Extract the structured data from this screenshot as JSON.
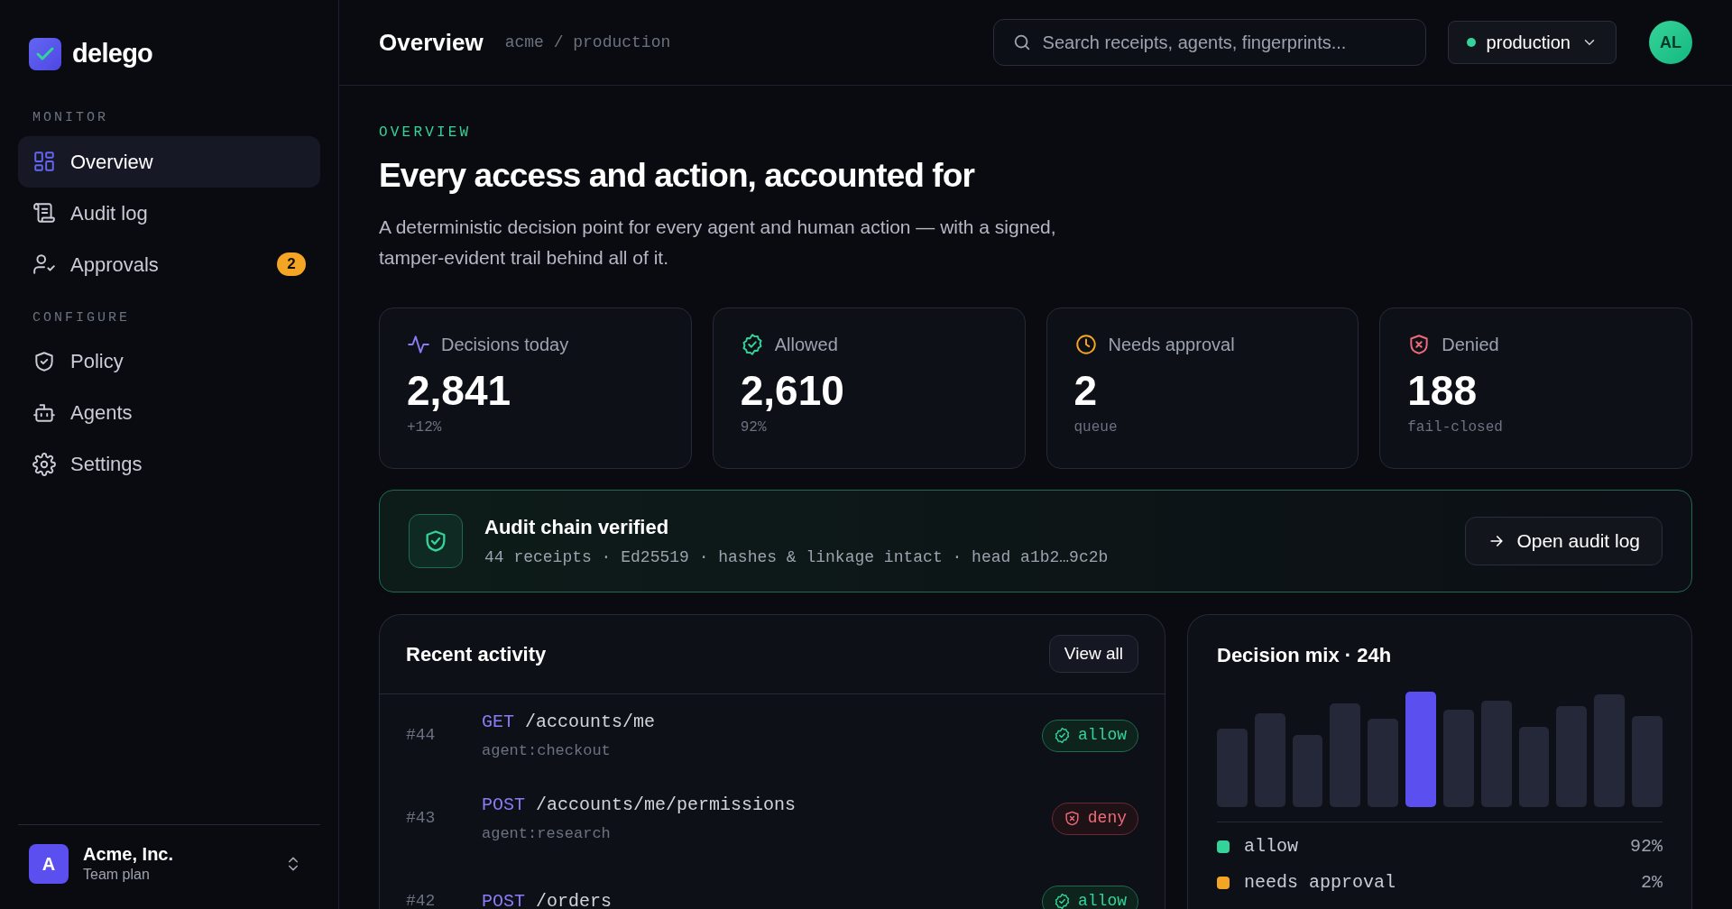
{
  "brand": "delego",
  "sidebar": {
    "sections": [
      {
        "heading": "MONITOR",
        "items": [
          {
            "label": "Overview",
            "selected": true
          },
          {
            "label": "Audit log",
            "selected": false
          },
          {
            "label": "Approvals",
            "selected": false,
            "badge": "2"
          }
        ]
      },
      {
        "heading": "CONFIGURE",
        "items": [
          {
            "label": "Policy",
            "selected": false
          },
          {
            "label": "Agents",
            "selected": false
          },
          {
            "label": "Settings",
            "selected": false
          }
        ]
      }
    ],
    "account": {
      "initial": "A",
      "name": "Acme, Inc.",
      "plan": "Team plan"
    }
  },
  "header": {
    "title": "Overview",
    "breadcrumb": "acme / production",
    "search": {
      "placeholder": "Search receipts, agents, fingerprints..."
    },
    "environment": "production",
    "avatar": "AL"
  },
  "hero": {
    "eyebrow": "OVERVIEW",
    "heading": "Every access and action, accounted for",
    "description": "A deterministic decision point for every agent and human action — with a signed, tamper-evident trail behind all of it."
  },
  "stats": [
    {
      "kind": "activity",
      "label": "Decisions today",
      "value": "2,841",
      "note": "+12%"
    },
    {
      "kind": "allowed",
      "label": "Allowed",
      "value": "2,610",
      "note": "92%"
    },
    {
      "kind": "pending",
      "label": "Needs approval",
      "value": "2",
      "note": "queue"
    },
    {
      "kind": "denied",
      "label": "Denied",
      "value": "188",
      "note": "fail-closed"
    }
  ],
  "audit": {
    "title": "Audit chain verified",
    "details": "44 receipts · Ed25519 · hashes & linkage intact · head a1b2…9c2b",
    "button": "Open audit log"
  },
  "activity": {
    "title": "Recent activity",
    "button": "View all",
    "rows": [
      {
        "id": "#44",
        "method": "GET",
        "path": "/accounts/me",
        "agent": "agent:checkout",
        "decision": {
          "kind": "allow",
          "label": "allow"
        }
      },
      {
        "id": "#43",
        "method": "POST",
        "path": "/accounts/me/permissions",
        "agent": "agent:research",
        "decision": {
          "kind": "deny",
          "label": "deny"
        }
      },
      {
        "id": "#42",
        "method": "POST",
        "path": "/orders",
        "decision": {
          "kind": "allow",
          "label": "allow"
        }
      }
    ]
  },
  "mix": {
    "title": "Decision mix · 24h",
    "legend": [
      {
        "label": "allow",
        "value": "92%",
        "color": "#34d399"
      },
      {
        "label": "needs approval",
        "value": "2%",
        "color": "#f5a524"
      }
    ]
  }
}
